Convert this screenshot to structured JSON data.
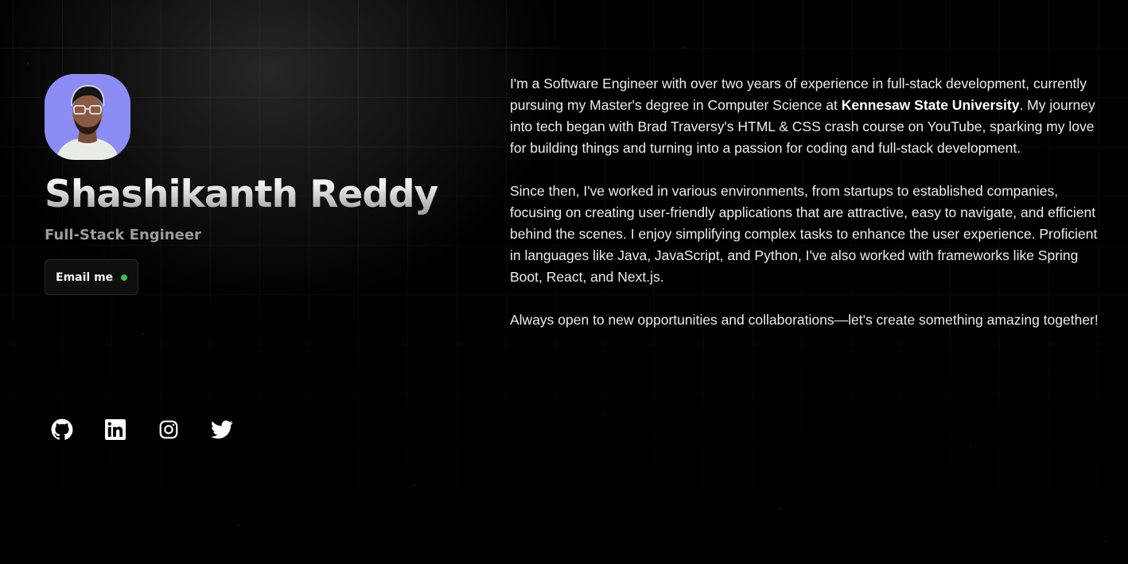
{
  "profile": {
    "name": "Shashikanth Reddy",
    "role": "Full-Stack Engineer",
    "email_button_label": "Email me",
    "status_color": "#3fb950",
    "avatar_bg_color": "#8c8cf4"
  },
  "about": {
    "p1_a": "I'm a Software Engineer with over two years of experience in full-stack development, currently pursuing my Master's degree in Computer Science at ",
    "p1_bold": "Kennesaw State University",
    "p1_b": ". My journey into tech began with Brad Traversy's HTML & CSS crash course on YouTube, sparking my love for building things and turning into a passion for coding and full-stack development.",
    "p2": "Since then, I've worked in various environments, from startups to established companies, focusing on creating user-friendly applications that are attractive, easy to navigate, and efficient behind the scenes. I enjoy simplifying complex tasks to enhance the user experience. Proficient in languages like Java, JavaScript, and Python, I've also worked with frameworks like Spring Boot, React, and Next.js.",
    "p3": "Always open to new opportunities and collaborations—let's create something amazing together!"
  },
  "socials": [
    {
      "icon": "github-icon"
    },
    {
      "icon": "linkedin-icon"
    },
    {
      "icon": "instagram-icon"
    },
    {
      "icon": "twitter-icon"
    }
  ]
}
